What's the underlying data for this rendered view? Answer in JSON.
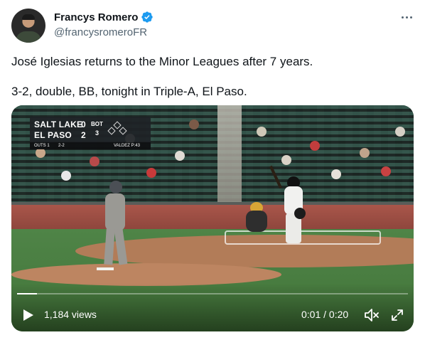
{
  "author": {
    "display_name": "Francys Romero",
    "handle": "@francysromeroFR",
    "verified": true,
    "avatar_icon": "profile-photo"
  },
  "tweet": {
    "line1": "José Iglesias returns to the Minor Leagues after 7 years.",
    "line2": "3-2, double, BB, tonight in Triple-A, El Paso."
  },
  "video": {
    "scoreboard": {
      "team1": "SALT LAKE",
      "score1": "0",
      "team2": "EL PASO",
      "score2": "2",
      "half": "BOT",
      "inning": "3",
      "outs": "OUTS 1",
      "count": "2-2",
      "pitcher": "VALDEZ P:43"
    },
    "views": "1,184 views",
    "time": "0:01 / 0:20",
    "progress": 0.05
  },
  "colors": {
    "verified_blue": "#1d9bf0",
    "secondary_text": "#536471",
    "primary_text": "#0f1419"
  },
  "icons": [
    "verified-badge-icon",
    "more-options-icon",
    "play-icon",
    "mute-icon",
    "fullscreen-icon"
  ]
}
